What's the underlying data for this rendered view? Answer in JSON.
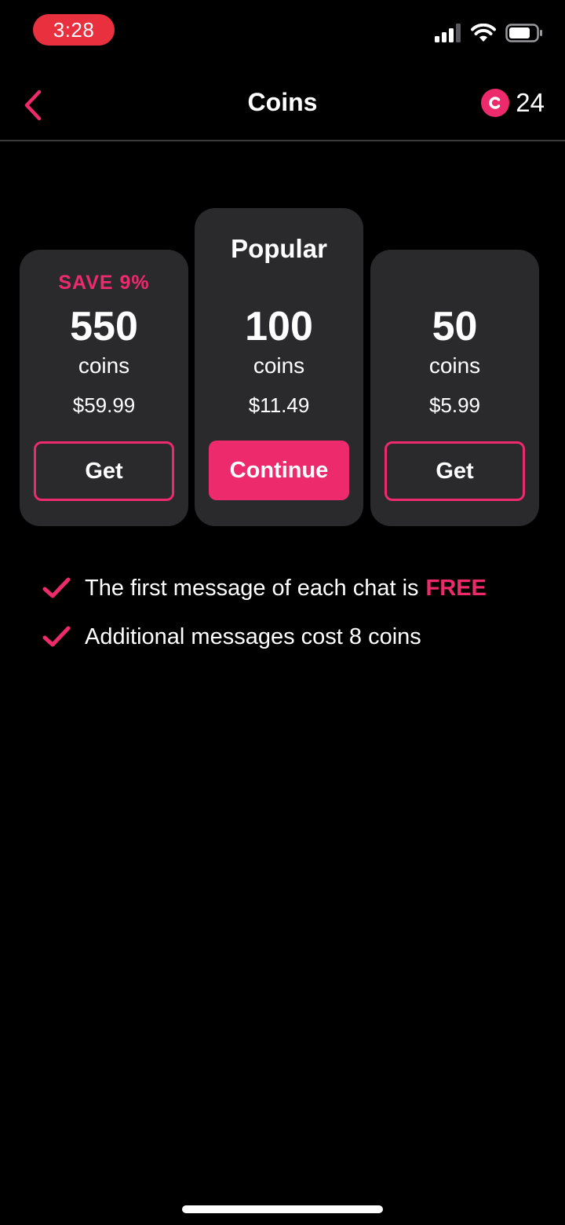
{
  "status_bar": {
    "time": "3:28"
  },
  "nav": {
    "title": "Coins",
    "balance": "24"
  },
  "packages": [
    {
      "badge": "SAVE 9%",
      "amount": "550",
      "unit": "coins",
      "price": "$59.99",
      "button": "Get"
    },
    {
      "badge": "Popular",
      "amount": "100",
      "unit": "coins",
      "price": "$11.49",
      "button": "Continue"
    },
    {
      "amount": "50",
      "unit": "coins",
      "price": "$5.99",
      "button": "Get"
    }
  ],
  "features": [
    {
      "text": "The first message of each chat is",
      "highlight": "FREE"
    },
    {
      "text": "Additional messages cost 8 coins"
    }
  ],
  "colors": {
    "accent": "#ec2a6c",
    "card": "#2a2a2c",
    "background": "#000000",
    "time_pill": "#e8303f"
  }
}
